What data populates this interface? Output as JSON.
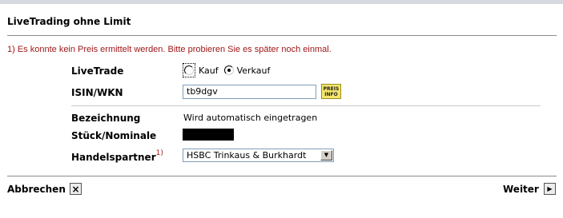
{
  "title": "LiveTrading ohne Limit",
  "error_message": "1) Es konnte kein Preis ermittelt werden. Bitte probieren Sie es später noch einmal.",
  "form": {
    "livetrade": {
      "label": "LiveTrade",
      "options": [
        {
          "label": "Kauf",
          "checked": false
        },
        {
          "label": "Verkauf",
          "checked": true
        }
      ]
    },
    "isin": {
      "label": "ISIN/WKN",
      "value": "tb9dgv",
      "preis_info_line1": "PREIS",
      "preis_info_line2": "INFO"
    },
    "bezeichnung": {
      "label": "Bezeichnung",
      "value": "Wird automatisch eingetragen"
    },
    "stueck": {
      "label": "Stück/Nominale"
    },
    "handelspartner": {
      "label": "Handelspartner",
      "footnote": "1)",
      "selected": "HSBC Trinkaus & Burkhardt"
    }
  },
  "footer": {
    "cancel_label": "Abbrechen",
    "next_label": "Weiter"
  },
  "colors": {
    "error": "#a01818",
    "preis_info_bg": "#f3e56a"
  }
}
